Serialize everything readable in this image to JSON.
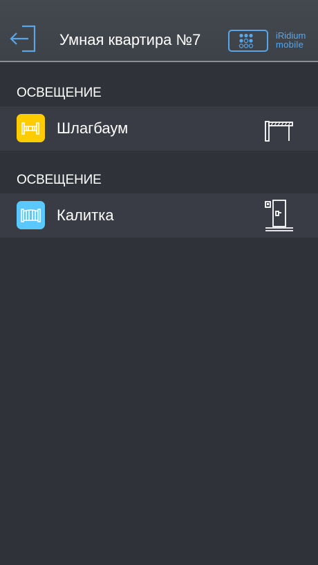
{
  "header": {
    "title": "Умная квартира №7",
    "back_icon": "exit-arrow-icon",
    "brand": {
      "name": "iRidium",
      "sub": "mobile",
      "accent_color": "#5aa6e8"
    }
  },
  "sections": [
    {
      "label": "ОСВЕЩЕНИЕ",
      "device": {
        "label": "Шлагбаум",
        "icon": "barrier-icon",
        "icon_color": "#ffcc00",
        "glyph": "barrier-gate-glyph-icon"
      }
    },
    {
      "label": "ОСВЕЩЕНИЕ",
      "device": {
        "label": "Калитка",
        "icon": "gate-icon",
        "icon_color": "#5ac8fa",
        "glyph": "door-glyph-icon"
      }
    }
  ],
  "colors": {
    "background": "#2f3239",
    "header": "#44484f",
    "row": "#393c44"
  }
}
